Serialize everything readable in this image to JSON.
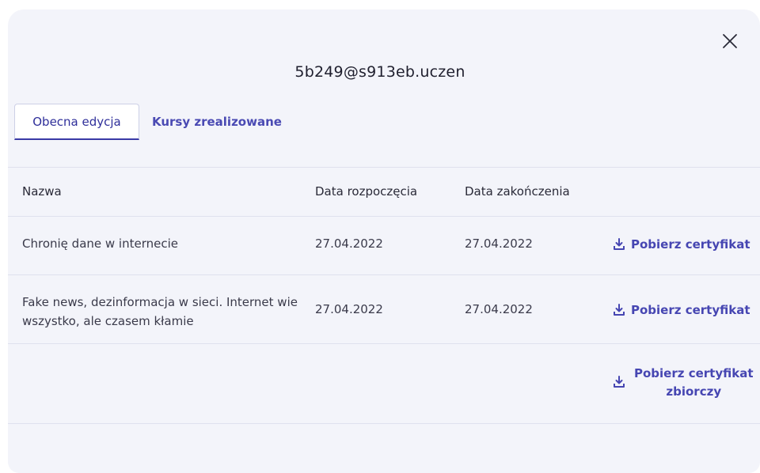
{
  "dialog": {
    "title": "5b249@s913eb.uczen",
    "close_label": "×"
  },
  "tabs": [
    {
      "label": "Obecna edycja",
      "active": true
    },
    {
      "label": "Kursy zrealizowane",
      "active": false
    }
  ],
  "table": {
    "headers": [
      "Nazwa",
      "Data rozpoczęcia",
      "Data zakończenia"
    ],
    "rows": [
      {
        "name_line1": "Chronię dane w internecie",
        "name_line2": "",
        "start": "27.04.2022",
        "end": "27.04.2022",
        "action": "Pobierz certyfikat"
      },
      {
        "name_line1": "Fake news, dezinformacja w sieci. Internet wie",
        "name_line2": "wszystko, ale czasem kłamie",
        "start": "27.04.2022",
        "end": "27.04.2022",
        "action": "Pobierz certyfikat"
      }
    ],
    "bulk_action": {
      "line1": "Pobierz certyfikat",
      "line2": "zbiorczy"
    }
  },
  "colors": {
    "accent": "#4646b2",
    "modal_bg": "#f3f4fa",
    "divider": "#dfe1ee"
  },
  "icons": {
    "close": "close-icon",
    "download": "download-icon"
  }
}
